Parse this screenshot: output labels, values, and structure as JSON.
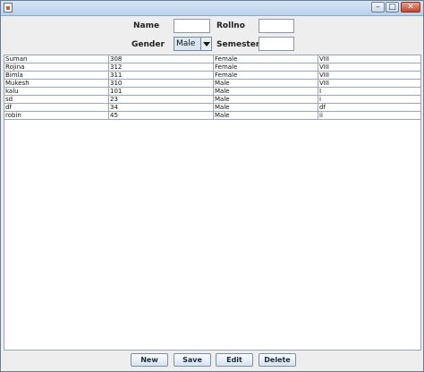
{
  "form": {
    "name_label": "Name",
    "rollno_label": "Rollno",
    "gender_label": "Gender",
    "semester_label": "Semester",
    "name_value": "",
    "rollno_value": "",
    "gender_value": "Male",
    "semester_value": ""
  },
  "table": {
    "rows": [
      [
        "Suman",
        "308",
        "Female",
        "VIII"
      ],
      [
        "Rojina",
        "312",
        "Female",
        "VIII"
      ],
      [
        "Bimla",
        "311",
        "Female",
        "VIII"
      ],
      [
        "Mukesh",
        "310",
        "Male",
        "VIII"
      ],
      [
        "kalu",
        "101",
        "Male",
        "I"
      ],
      [
        "sd",
        "23",
        "Male",
        "i"
      ],
      [
        "df",
        "34",
        "Male",
        "df"
      ],
      [
        "robin",
        "45",
        "Male",
        "ii"
      ]
    ]
  },
  "buttons": {
    "new_label": "New",
    "save_label": "Save",
    "edit_label": "Edit",
    "delete_label": "Delete"
  },
  "icons": {
    "app": "java-app-icon",
    "minimize": "minimize-icon",
    "maximize": "maximize-icon",
    "close": "close-icon",
    "dropdown": "chevron-down-icon"
  }
}
